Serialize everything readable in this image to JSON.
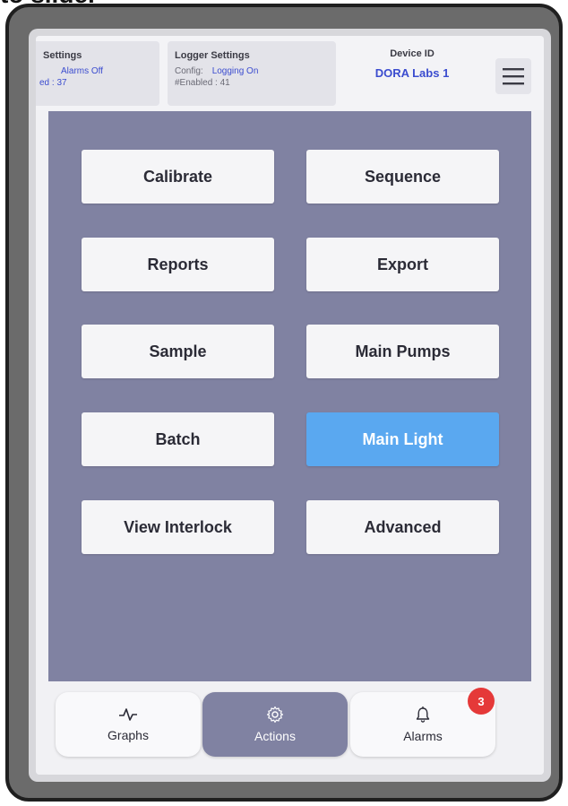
{
  "caption": "to slide.",
  "header": {
    "alarm_settings": {
      "title": "Settings",
      "status": "Alarms Off",
      "enabled_text": "ed : 37"
    },
    "logger_settings": {
      "title": "Logger Settings",
      "config_label": "Config:",
      "config_value": "Logging On",
      "enabled_text": "#Enabled : 41"
    },
    "device": {
      "label": "Device ID",
      "value": "DORA Labs 1"
    },
    "menu_icon": "hamburger-menu-icon"
  },
  "actions": {
    "buttons": [
      {
        "label": "Calibrate"
      },
      {
        "label": "Sequence"
      },
      {
        "label": "Reports"
      },
      {
        "label": "Export"
      },
      {
        "label": "Sample"
      },
      {
        "label": "Main Pumps"
      },
      {
        "label": "Batch"
      },
      {
        "label": "Main Light"
      },
      {
        "label": "View Interlock"
      },
      {
        "label": "Advanced"
      }
    ],
    "active_button": "Main Light"
  },
  "nav": {
    "tabs": [
      {
        "label": "Graphs",
        "icon": "pulse-icon"
      },
      {
        "label": "Actions",
        "icon": "gear-icon"
      },
      {
        "label": "Alarms",
        "icon": "bell-icon"
      }
    ],
    "active_tab": "Actions",
    "alarm_badge": "3"
  },
  "colors": {
    "action_area": "#8082a2",
    "active_button": "#5aa8f0",
    "accent_text": "#3b4ccf",
    "badge": "#e53939"
  }
}
